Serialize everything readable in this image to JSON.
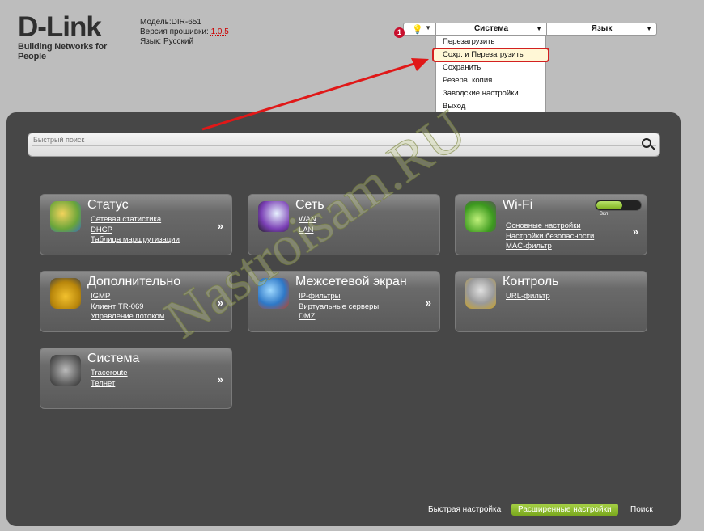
{
  "brand": {
    "name": "D-Link",
    "tagline": "Building Networks for People"
  },
  "device": {
    "model_label": "Модель:",
    "model": "DIR-651",
    "firmware_label": "Версия прошивки:",
    "firmware": "1.0.5",
    "language_label": "Язык:",
    "language": "Русский"
  },
  "topbar": {
    "badge_count": "1",
    "system_select": "Система",
    "language_select": "Язык",
    "dropdown": [
      "Перезагрузить",
      "Сохр. и Перезагрузить",
      "Сохранить",
      "Резерв. копия",
      "Заводские настройки",
      "Выход"
    ]
  },
  "search": {
    "placeholder": "Быстрый поиск"
  },
  "tiles": [
    {
      "title": "Статус",
      "links": [
        "Сетевая статистика",
        "DHCP",
        "Таблица маршрутизации"
      ]
    },
    {
      "title": "Сеть",
      "links": [
        "WAN",
        "LAN"
      ]
    },
    {
      "title": "Wi-Fi",
      "links": [
        "Основные настройки",
        "Настройки безопасности",
        "MAC-фильтр"
      ],
      "toggle_label": "Вкл"
    },
    {
      "title": "Дополнительно",
      "links": [
        "IGMP",
        "Клиент TR-069",
        "Управление потоком"
      ]
    },
    {
      "title": "Межсетевой экран",
      "links": [
        "IP-фильтры",
        "Виртуальные серверы",
        "DMZ"
      ]
    },
    {
      "title": "Контроль",
      "links": [
        "URL-фильтр"
      ]
    },
    {
      "title": "Система",
      "links": [
        "Traceroute",
        "Телнет"
      ]
    }
  ],
  "more_glyph": "»",
  "footer": {
    "quick": "Быстрая настройка",
    "advanced": "Расширенные настройки",
    "search": "Поиск"
  },
  "watermark": "Nastroisam.RU",
  "colors": {
    "accent_green": "#8cbf2a",
    "highlight_red": "#d32020",
    "panel": "#474747"
  }
}
